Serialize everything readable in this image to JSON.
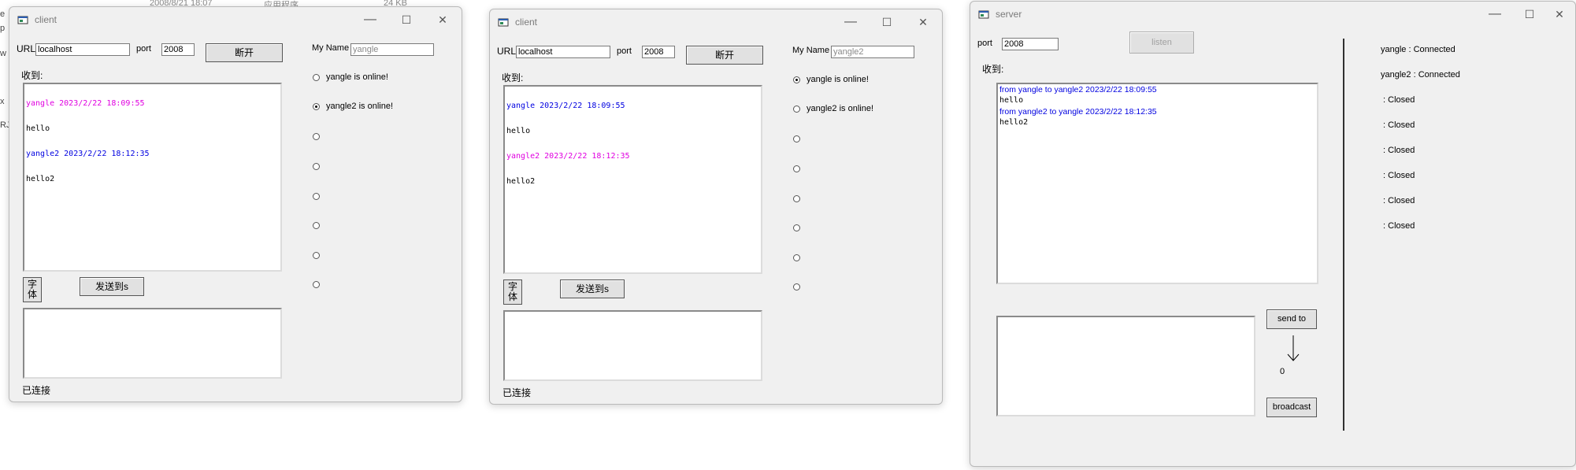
{
  "background": {
    "explorer_date": "2008/8/21 18:07",
    "explorer_type": "应用程序",
    "explorer_size": "24 KB",
    "left_fragments": [
      "e",
      "p",
      "w",
      "x",
      "RJ"
    ]
  },
  "window_controls": {
    "minimize": "—",
    "maximize": "☐",
    "close": "✕"
  },
  "clients": [
    {
      "title": "client",
      "url_label": "URL",
      "url_value": "localhost",
      "port_label": "port",
      "port_value": "2008",
      "disconnect_label": "断开",
      "myname_label": "My Name",
      "myname_value": "yangle",
      "received_label": "收到:",
      "messages": [
        {
          "text": "yangle 2023/2/22 18:09:55",
          "color": "#e000e0"
        },
        {
          "text": "hello",
          "color": "#000000"
        },
        {
          "text": "yangle2 2023/2/22 18:12:35",
          "color": "#0000e0"
        },
        {
          "text": "hello2",
          "color": "#000000"
        }
      ],
      "font_button": "字体",
      "send_to_label": "发送到s",
      "status": "已连接",
      "users": [
        {
          "label": "yangle is online!",
          "checked": false
        },
        {
          "label": "yangle2 is online!",
          "checked": true
        },
        {
          "label": "",
          "checked": false
        },
        {
          "label": "",
          "checked": false
        },
        {
          "label": "",
          "checked": false
        },
        {
          "label": "",
          "checked": false
        },
        {
          "label": "",
          "checked": false
        },
        {
          "label": "",
          "checked": false
        }
      ]
    },
    {
      "title": "client",
      "url_label": "URL",
      "url_value": "localhost",
      "port_label": "port",
      "port_value": "2008",
      "disconnect_label": "断开",
      "myname_label": "My Name",
      "myname_value": "yangle2",
      "received_label": "收到:",
      "messages": [
        {
          "text": "yangle 2023/2/22 18:09:55",
          "color": "#0000e0"
        },
        {
          "text": "hello",
          "color": "#000000"
        },
        {
          "text": "yangle2 2023/2/22 18:12:35",
          "color": "#e000e0"
        },
        {
          "text": "hello2",
          "color": "#000000"
        }
      ],
      "font_button": "字体",
      "send_to_label": "发送到s",
      "status": "已连接",
      "users": [
        {
          "label": "yangle is online!",
          "checked": true
        },
        {
          "label": "yangle2 is online!",
          "checked": false
        },
        {
          "label": "",
          "checked": false
        },
        {
          "label": "",
          "checked": false
        },
        {
          "label": "",
          "checked": false
        },
        {
          "label": "",
          "checked": false
        },
        {
          "label": "",
          "checked": false
        },
        {
          "label": "",
          "checked": false
        }
      ]
    }
  ],
  "server": {
    "title": "server",
    "port_label": "port",
    "port_value": "2008",
    "listen_label": "listen",
    "received_label": "收到:",
    "log": [
      {
        "text": "from yangle to yangle2 2023/2/22 18:09:55",
        "color": "#0000e0"
      },
      {
        "text": "hello",
        "color": "#000000"
      },
      {
        "text": "from yangle2 to yangle 2023/2/22 18:12:35",
        "color": "#0000e0"
      },
      {
        "text": "hello2",
        "color": "#000000"
      }
    ],
    "send_to_label": "send to",
    "counter": "0",
    "broadcast_label": "broadcast",
    "connections": [
      "yangle : Connected",
      "yangle2 : Connected",
      " : Closed",
      " : Closed",
      " : Closed",
      " : Closed",
      " : Closed",
      " : Closed"
    ]
  }
}
